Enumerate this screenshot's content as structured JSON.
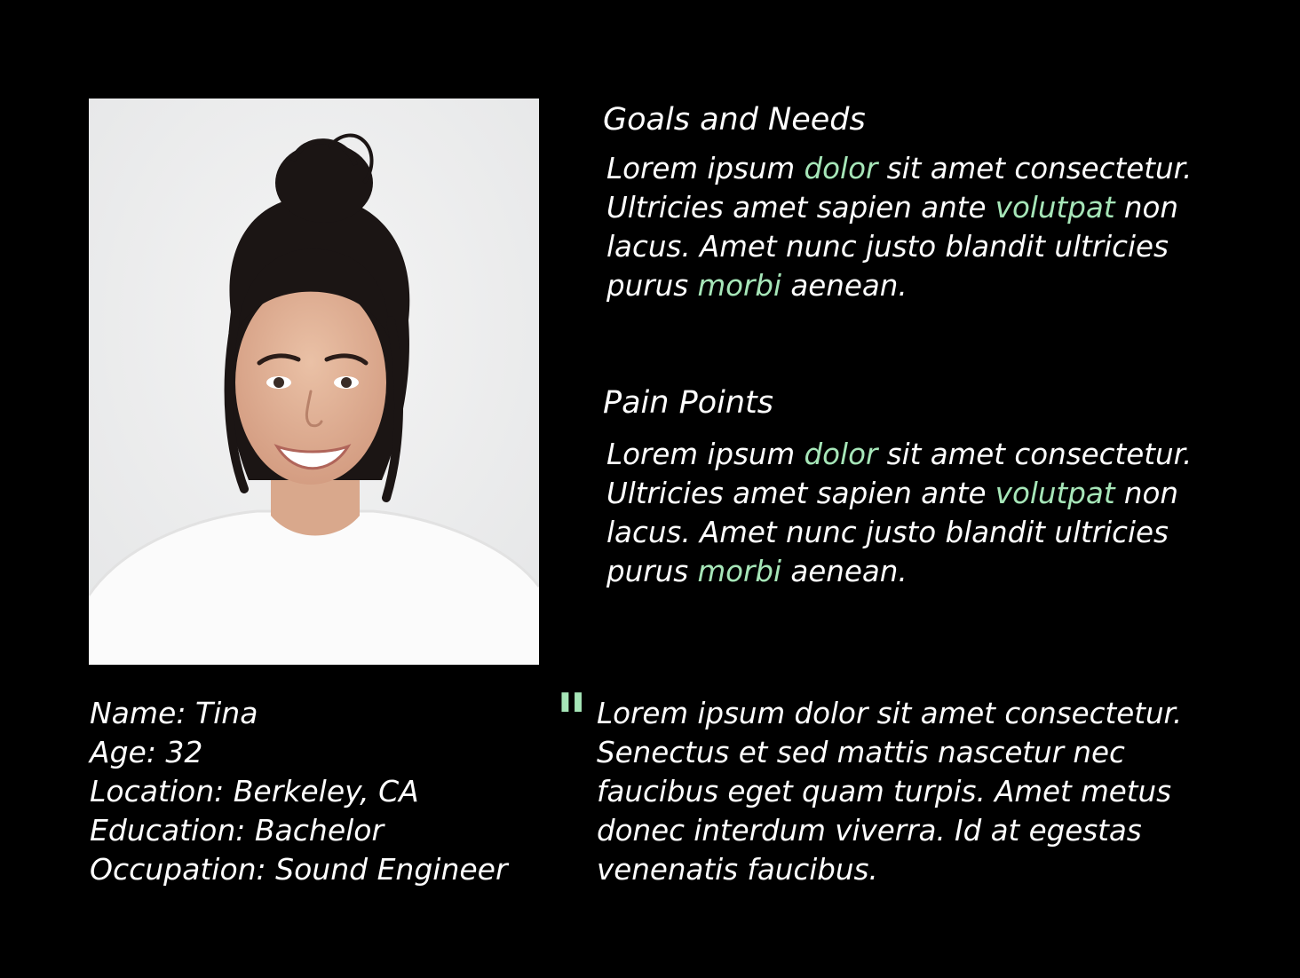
{
  "colors": {
    "background": "#000000",
    "text": "#ffffff",
    "highlight": "#a6e6b8"
  },
  "photo": {
    "description_icon": "portrait-photo"
  },
  "goals": {
    "title": "Goals and Needs",
    "lines": [
      [
        "Lorem ipsum ",
        "dolor",
        " sit amet consectetur."
      ],
      [
        "Ultricies amet sapien ante ",
        "volutpat",
        " non"
      ],
      [
        "lacus. Amet nunc justo blandit ultricies",
        "",
        ""
      ],
      [
        "purus ",
        "morbi",
        " aenean."
      ]
    ]
  },
  "pain_points": {
    "title": "Pain Points",
    "lines": [
      [
        "Lorem ipsum ",
        "dolor",
        " sit amet consectetur."
      ],
      [
        "Ultricies amet sapien ante ",
        "volutpat",
        " non"
      ],
      [
        "lacus. Amet nunc justo blandit ultricies",
        "",
        ""
      ],
      [
        "purus ",
        "morbi",
        " aenean."
      ]
    ]
  },
  "profile": {
    "name": "Name: Tina",
    "age": "Age: 32",
    "location": "Location: Berkeley, CA",
    "education": "Education: Bachelor",
    "occupation": "Occupation: Sound Engineer"
  },
  "quote": {
    "mark": "\"",
    "lines": [
      "Lorem ipsum dolor sit amet consectetur.",
      "Senectus et sed mattis nascetur nec",
      "faucibus eget quam turpis. Amet metus",
      "donec interdum viverra. Id at egestas",
      "venenatis faucibus."
    ]
  }
}
